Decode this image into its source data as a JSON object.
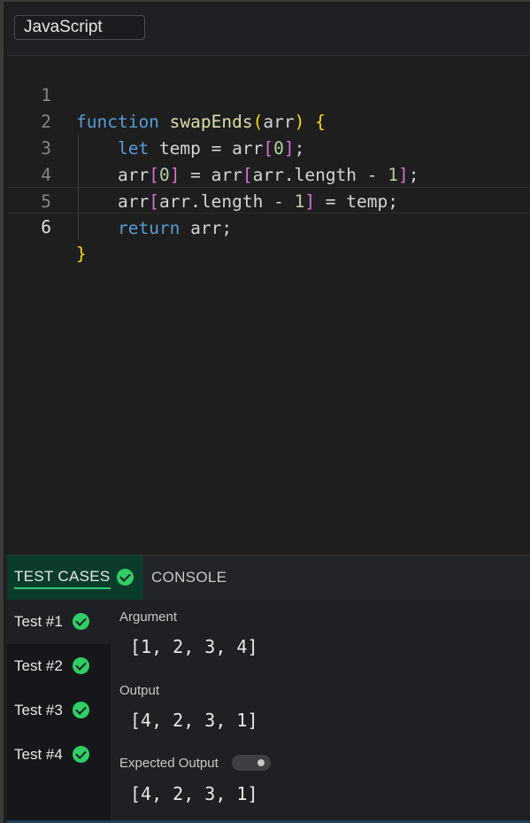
{
  "topbar": {
    "language": "JavaScript"
  },
  "editor": {
    "line_numbers": [
      "1",
      "2",
      "3",
      "4",
      "5",
      "6"
    ],
    "active_line": 6,
    "lines": [
      [
        {
          "t": "function",
          "c": "kw"
        },
        {
          "t": " "
        },
        {
          "t": "swapEnds",
          "c": "fn"
        },
        {
          "t": "(",
          "c": "br1"
        },
        {
          "t": "arr",
          "c": "var"
        },
        {
          "t": ")",
          "c": "br1"
        },
        {
          "t": " "
        },
        {
          "t": "{",
          "c": "br1"
        }
      ],
      [
        {
          "t": "    "
        },
        {
          "t": "let",
          "c": "kw"
        },
        {
          "t": " temp = arr"
        },
        {
          "t": "[",
          "c": "br2"
        },
        {
          "t": "0",
          "c": "num"
        },
        {
          "t": "]",
          "c": "br2"
        },
        {
          "t": ";"
        }
      ],
      [
        {
          "t": "    arr"
        },
        {
          "t": "[",
          "c": "br2"
        },
        {
          "t": "0",
          "c": "num"
        },
        {
          "t": "]",
          "c": "br2"
        },
        {
          "t": " = arr"
        },
        {
          "t": "[",
          "c": "br2"
        },
        {
          "t": "arr.length - "
        },
        {
          "t": "1",
          "c": "num"
        },
        {
          "t": "]",
          "c": "br2"
        },
        {
          "t": ";"
        }
      ],
      [
        {
          "t": "    arr"
        },
        {
          "t": "[",
          "c": "br2"
        },
        {
          "t": "arr.length - "
        },
        {
          "t": "1",
          "c": "num"
        },
        {
          "t": "]",
          "c": "br2"
        },
        {
          "t": " = temp;"
        }
      ],
      [
        {
          "t": "    "
        },
        {
          "t": "return",
          "c": "kw"
        },
        {
          "t": " arr;"
        }
      ],
      [
        {
          "t": "}",
          "c": "br1"
        }
      ]
    ]
  },
  "panel": {
    "tabs": {
      "test_cases": "TEST CASES",
      "console": "CONSOLE"
    },
    "tests": [
      {
        "label": "Test #1",
        "passed": true
      },
      {
        "label": "Test #2",
        "passed": true
      },
      {
        "label": "Test #3",
        "passed": true
      },
      {
        "label": "Test #4",
        "passed": true
      }
    ],
    "details": {
      "argument_label": "Argument",
      "argument_value": "[1, 2, 3, 4]",
      "output_label": "Output",
      "output_value": "[4, 2, 3, 1]",
      "expected_label": "Expected Output",
      "expected_value": "[4, 2, 3, 1]",
      "expected_toggle_on": false
    }
  },
  "colors": {
    "pass": "#2fcf65",
    "active_tab_bg": "#0b3b2b",
    "keyword": "#569cd6",
    "function": "#dcdcaa",
    "bracket_gold": "#ffd700",
    "bracket_purple": "#da70d6",
    "number": "#b5cea8"
  }
}
